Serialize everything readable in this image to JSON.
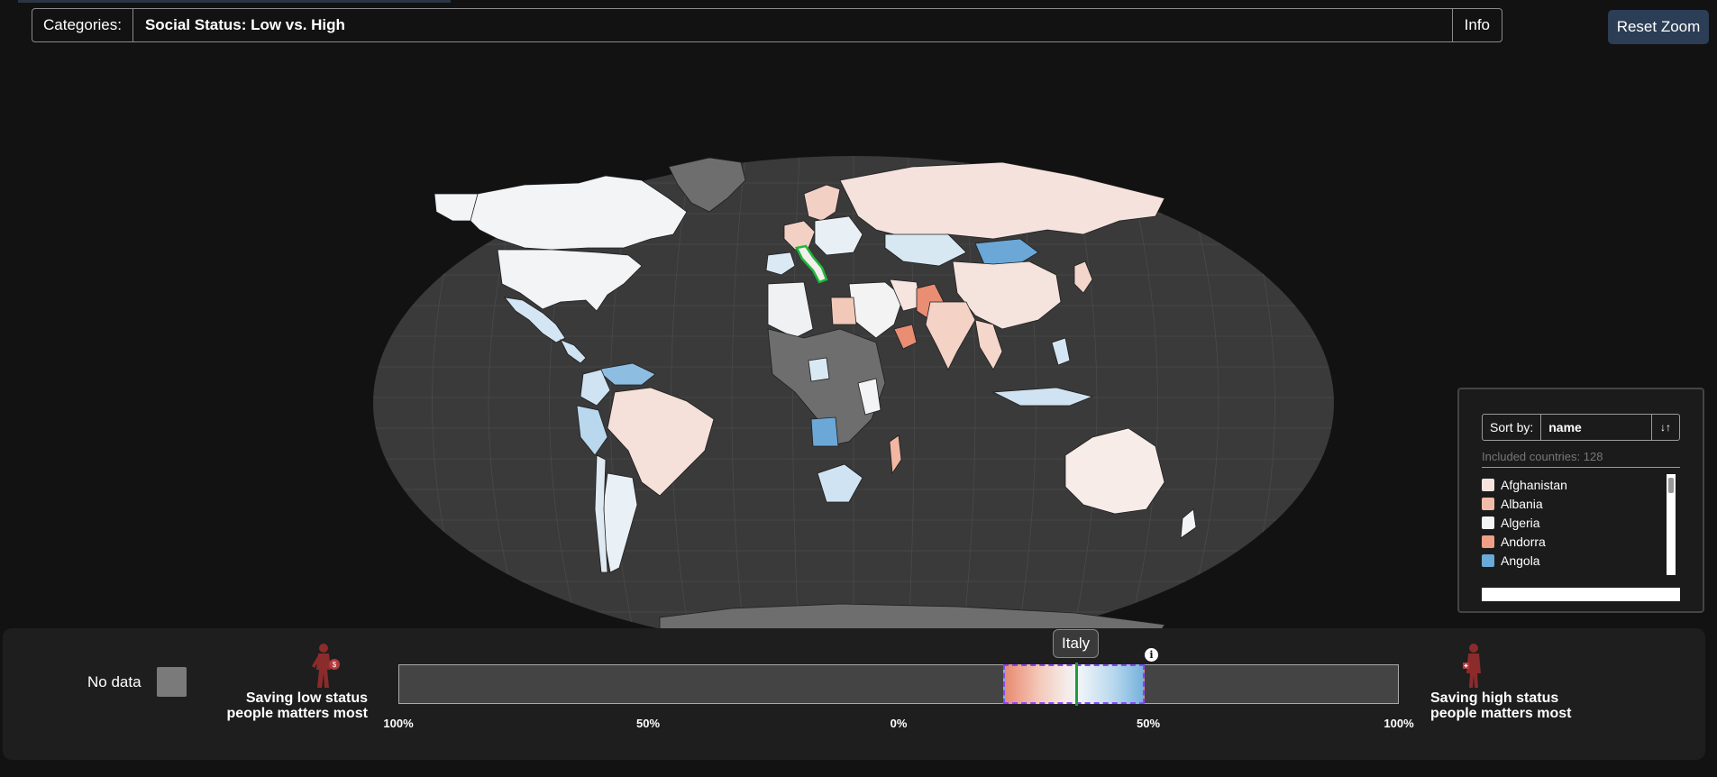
{
  "header": {
    "categories_label": "Categories:",
    "category_value": "Social Status: Low vs. High",
    "info_label": "Info",
    "reset_zoom_label": "Reset Zoom"
  },
  "map": {
    "selected_country": "Italy",
    "ocean_color": "#3a3a3a",
    "nodata_color": "#6e6e6e",
    "highlight_color": "#1fb83a"
  },
  "sidebar": {
    "sort_label": "Sort by:",
    "sort_value": "name",
    "sort_dir_icon": "↓↑",
    "included_text": "Included countries: 128",
    "countries": [
      {
        "name": "Afghanistan",
        "color": "#f7e4de"
      },
      {
        "name": "Albania",
        "color": "#f2bba9"
      },
      {
        "name": "Algeria",
        "color": "#f2f4f6"
      },
      {
        "name": "Andorra",
        "color": "#ee9f85"
      },
      {
        "name": "Angola",
        "color": "#6aa9d8"
      }
    ]
  },
  "legend": {
    "nodata_label": "No data",
    "low_label_1": "Saving low status",
    "low_label_2": "people matters most",
    "high_label_1": "Saving high status",
    "high_label_2": "people matters most",
    "tooltip": "Italy",
    "info_icon": "i",
    "ticks": [
      "100%",
      "50%",
      "0%",
      "50%",
      "100%"
    ]
  }
}
